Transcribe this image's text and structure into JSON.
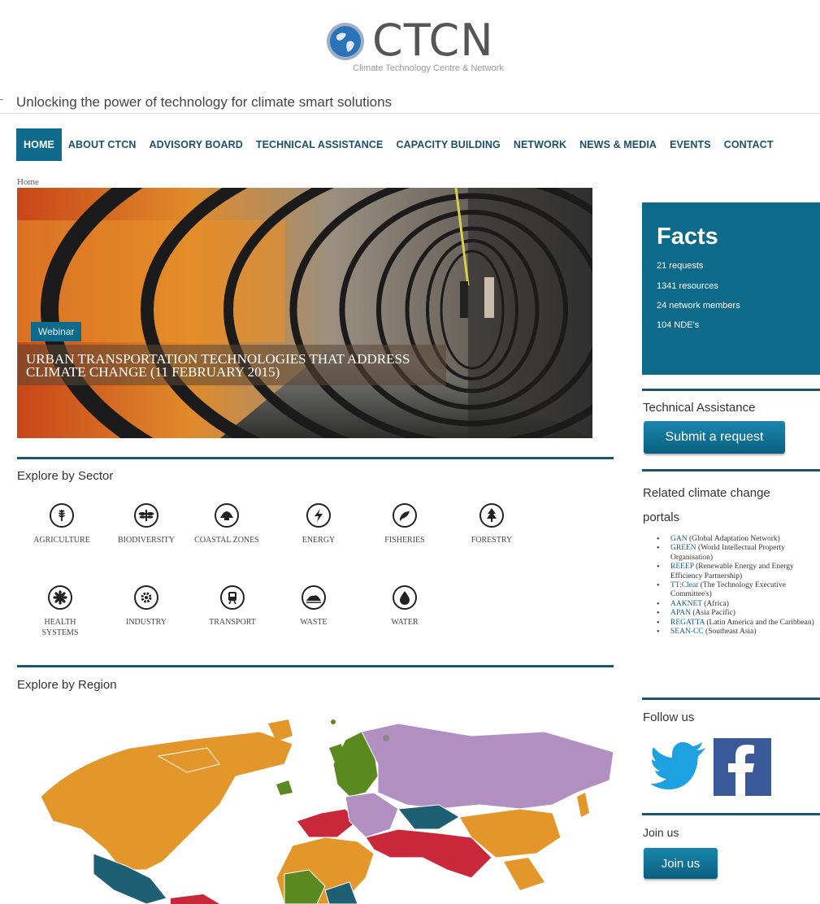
{
  "header": {
    "logo_text": "CTCN",
    "logo_subtitle": "Climate Technology Centre & Network",
    "tagline": "Unlocking the power of technology for climate smart solutions"
  },
  "nav": [
    {
      "label": "HOME",
      "active": true
    },
    {
      "label": "ABOUT CTCN"
    },
    {
      "label": "ADVISORY BOARD"
    },
    {
      "label": "TECHNICAL ASSISTANCE"
    },
    {
      "label": "CAPACITY BUILDING"
    },
    {
      "label": "NETWORK"
    },
    {
      "label": "NEWS & MEDIA"
    },
    {
      "label": "EVENTS"
    },
    {
      "label": "CONTACT"
    }
  ],
  "breadcrumb": "Home",
  "hero": {
    "badge": "Webinar",
    "title": "URBAN TRANSPORTATION TECHNOLOGIES THAT ADDRESS CLIMATE CHANGE (11 FEBRUARY 2015)"
  },
  "sectors": {
    "title": "Explore by Sector",
    "items": [
      {
        "label": "AGRICULTURE",
        "icon": "wheat-icon"
      },
      {
        "label": "BIODIVERSITY",
        "icon": "dragonfly-icon"
      },
      {
        "label": "COASTAL ZONES",
        "icon": "shell-icon"
      },
      {
        "label": "ENERGY",
        "icon": "lightning-icon"
      },
      {
        "label": "FISHERIES",
        "icon": "fish-icon"
      },
      {
        "label": "FORESTRY",
        "icon": "tree-icon"
      },
      {
        "label": "HEALTH SYSTEMS",
        "icon": "health-icon"
      },
      {
        "label": "INDUSTRY",
        "icon": "gear-icon"
      },
      {
        "label": "TRANSPORT",
        "icon": "train-icon"
      },
      {
        "label": "WASTE",
        "icon": "landfill-icon"
      },
      {
        "label": "WATER",
        "icon": "water-drop-icon"
      }
    ]
  },
  "region": {
    "title": "Explore by Region"
  },
  "facts": {
    "title": "Facts",
    "items": [
      "21 requests",
      "1341 resources",
      "24 network members",
      "104 NDE's"
    ]
  },
  "technical_assistance": {
    "title": "Technical Assistance",
    "button": "Submit a request"
  },
  "portals": {
    "title": "Related climate change portals",
    "items": [
      {
        "link": "GAN",
        "rest": " (Global Adaptation Network)"
      },
      {
        "link": "GREEN",
        "rest": " (World Intellectual Property Organisation)"
      },
      {
        "link": "REEEP",
        "rest": " (Renewable Energy and Energy Efficiency Partnership)"
      },
      {
        "link": "TT:Clear",
        "rest": " (The Technology Executive Committee's)"
      },
      {
        "link": "AAKNET",
        "rest": " (Africa)"
      },
      {
        "link": "APAN",
        "rest": " (Asia Pacific)"
      },
      {
        "link": "REGATTA",
        "rest": " (Latin America and the Caribbean)"
      },
      {
        "link": "SEAN-CC",
        "rest": " (Southeast Asia)"
      }
    ]
  },
  "follow": {
    "title": "Follow us"
  },
  "join": {
    "title": "Join us",
    "button": "Join us"
  },
  "colors": {
    "brand_blue": "#0e6a8a",
    "rule": "#1e536e",
    "region_orange": "#e3962a",
    "region_purple": "#b18fc0",
    "region_green": "#5a8a1f",
    "region_red": "#c8283a",
    "region_teal": "#1f5f73"
  }
}
